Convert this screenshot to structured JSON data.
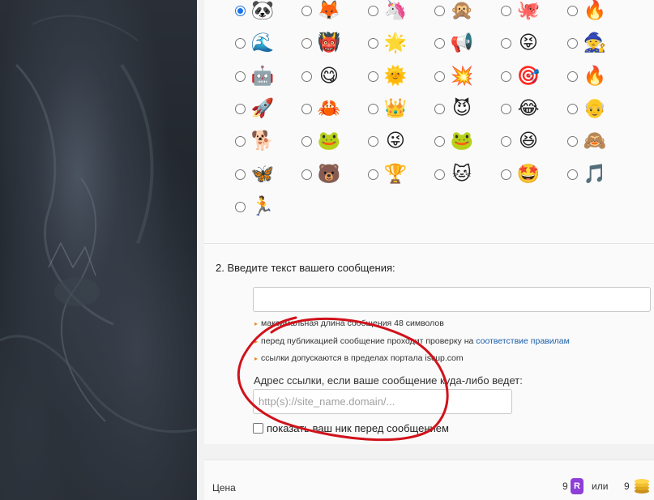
{
  "avatars": [
    [
      "🐼",
      "🦊",
      "🦄",
      "🙊",
      "🐙",
      "🔥"
    ],
    [
      "🌊",
      "👹",
      "🌟",
      "📢",
      "😝",
      "🧙"
    ],
    [
      "🤖",
      "😋",
      "🌞",
      "💥",
      "🎯",
      "🔥"
    ],
    [
      "🚀",
      "🦀",
      "👑",
      "😈",
      "😂",
      "👴"
    ],
    [
      "🐕",
      "🐸",
      "😜",
      "🐸",
      "😆",
      "🙈"
    ],
    [
      "🦋",
      "🐻",
      "🏆",
      "🐱",
      "🤩",
      "🎵"
    ],
    [
      "🏃"
    ]
  ],
  "avatar_names": [
    [
      "panda",
      "fox",
      "unicorn",
      "monkey",
      "octopus",
      "fire"
    ],
    [
      "wave",
      "ogre",
      "star",
      "megaphone",
      "laughing",
      "wizard-hat"
    ],
    [
      "robot",
      "yum",
      "sun",
      "omg",
      "target",
      "flame"
    ],
    [
      "rocket",
      "crab",
      "crown",
      "devil",
      "tears-of-joy",
      "harold"
    ],
    [
      "doge",
      "rainbow-pepe",
      "trollface",
      "pepe",
      "laughing-face",
      "see-no-evil"
    ],
    [
      "butterfly",
      "bear",
      "trophy",
      "cat",
      "star-struck",
      "music-notes"
    ],
    [
      "runner"
    ]
  ],
  "question2": "2. Введите текст вашего сообщения:",
  "notes": {
    "max_length": "максимальная длина сообщения 48 символов",
    "moderation_prefix": "перед публикацией сообщение проходит проверку на ",
    "moderation_link": "соответствие правилам",
    "links_allowed": "ссылки допускаются в пределах портала iscup.com"
  },
  "url_label": "Адрес ссылки, если ваше сообщение куда-либо ведет:",
  "url_placeholder": "http(s)://site_name.domain/...",
  "show_nick_label": "показать ваш ник перед сообщением",
  "price": {
    "label": "Цена",
    "amount1": "9",
    "coin1_glyph": "R",
    "or": "или",
    "amount2": "9"
  },
  "colors": {
    "accent": "#1a73e8",
    "link": "#1a5ea8",
    "bullet": "#e08a1e",
    "annotation": "#d0121b",
    "coin_purple": "#8e3fd8"
  }
}
